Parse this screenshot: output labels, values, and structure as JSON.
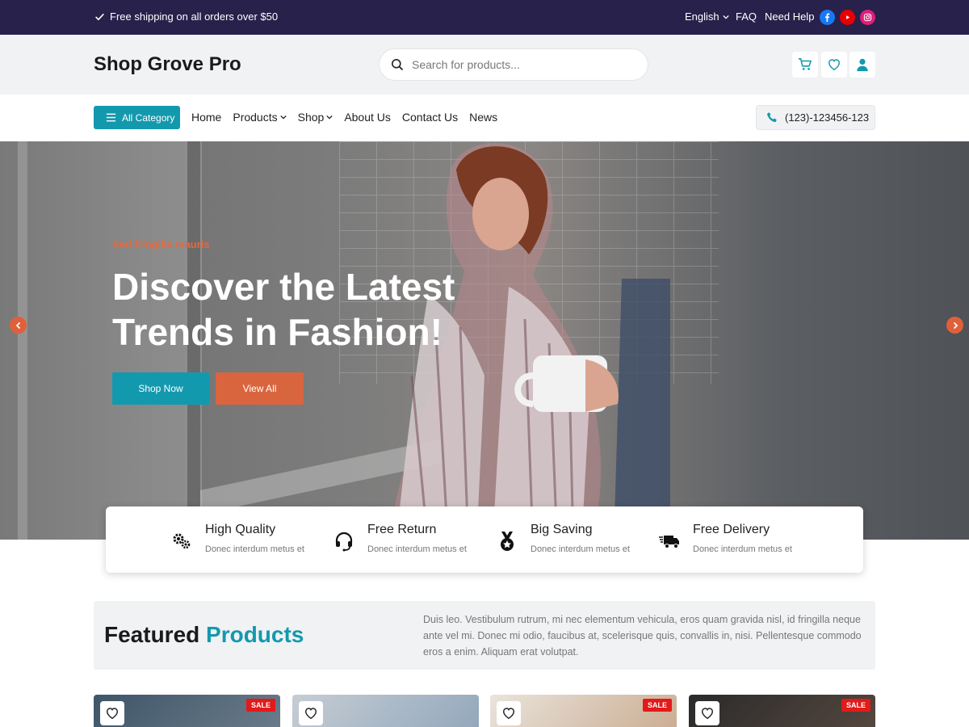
{
  "topbar": {
    "shipping": "Free shipping on all orders over $50",
    "language": "English",
    "faq": "FAQ",
    "help": "Need Help",
    "social": [
      "facebook-icon",
      "youtube-icon",
      "instagram-icon"
    ]
  },
  "header": {
    "logo": "Shop Grove Pro",
    "search_placeholder": "Search for products...",
    "icons": [
      "cart-icon",
      "heart-icon",
      "user-icon"
    ]
  },
  "nav": {
    "all_category": "All Category",
    "items": [
      {
        "label": "Home",
        "dropdown": false
      },
      {
        "label": "Products",
        "dropdown": true
      },
      {
        "label": "Shop",
        "dropdown": true
      },
      {
        "label": "About Us",
        "dropdown": false
      },
      {
        "label": "Contact Us",
        "dropdown": false
      },
      {
        "label": "News",
        "dropdown": false
      }
    ],
    "phone": "(123)-123456-123"
  },
  "hero": {
    "subtitle": "Sed fringilla mauris",
    "title": "Discover the Latest Trends in Fashion!",
    "shop_now": "Shop Now",
    "view_all": "View All"
  },
  "features": [
    {
      "title": "High Quality",
      "desc": "Donec interdum metus et",
      "icon": "gears-icon"
    },
    {
      "title": "Free Return",
      "desc": "Donec interdum metus et",
      "icon": "headset-icon"
    },
    {
      "title": "Big Saving",
      "desc": "Donec interdum metus et",
      "icon": "medal-icon"
    },
    {
      "title": "Free Delivery",
      "desc": "Donec interdum metus et",
      "icon": "truck-icon"
    }
  ],
  "featured": {
    "title_main": "Featured",
    "title_accent": "Products",
    "description": "Duis leo. Vestibulum rutrum, mi nec elementum vehicula, eros quam gravida nisl, id fringilla neque ante vel mi. Donec mi odio, faucibus at, scelerisque quis, convallis in, nisi. Pellentesque commodo eros a enim. Aliquam erat volutpat."
  },
  "products": [
    {
      "badge": "SALE"
    },
    {
      "badge": ""
    },
    {
      "badge": "SALE"
    },
    {
      "badge": "SALE"
    }
  ],
  "colors": {
    "topbar": "#27214b",
    "accent": "#1399ae",
    "orange": "#d9653f",
    "sale": "#e21a1a"
  }
}
